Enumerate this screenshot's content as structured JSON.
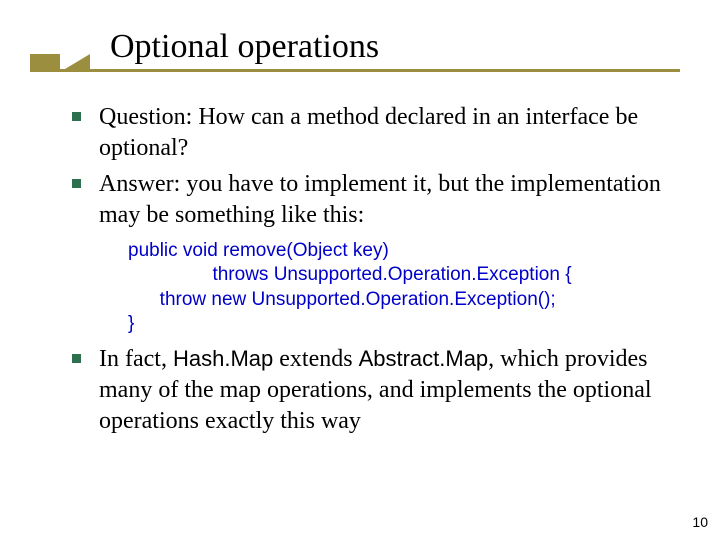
{
  "title": "Optional operations",
  "bullets": [
    {
      "text": "Question: How can a method declared in an interface be optional?"
    },
    {
      "text": "Answer: you have to implement it, but the implementation may be something like this:"
    }
  ],
  "code": {
    "line1": "public void remove(Object key)",
    "line2": "                throws Unsupported.Operation.Exception {",
    "line3": "      throw new Unsupported.Operation.Exception();",
    "line4": "}"
  },
  "final_bullet": {
    "prefix": "In fact, ",
    "tok1": "Hash.Map",
    "mid1": " extends ",
    "tok2": "Abstract.Map",
    "suffix": ", which provides many of the map operations, and implements the optional operations exactly this way"
  },
  "page_number": "10"
}
